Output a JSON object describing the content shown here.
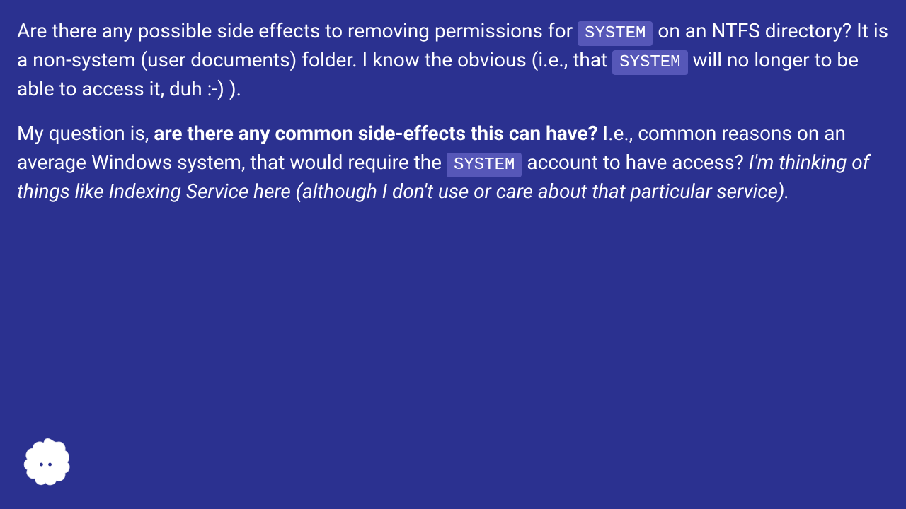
{
  "p1": {
    "t1": "Are there any possible side effects to removing permissions for ",
    "code1": "SYSTEM",
    "t2": " on an NTFS directory? It is a non-system (user documents) folder. I know the obvious (i.e., that ",
    "code2": "SYSTEM",
    "t3": " will no longer to be able to access it, duh :-) )."
  },
  "p2": {
    "t1": "My question is, ",
    "bold": "are there any common side-effects this can have?",
    "t2": " I.e., common reasons on an average Windows system, that would require the ",
    "code1": "SYSTEM",
    "t3": " account to have access? ",
    "italic": "I'm thinking of things like Indexing Service here (although I don't use or care about that particular service)."
  }
}
